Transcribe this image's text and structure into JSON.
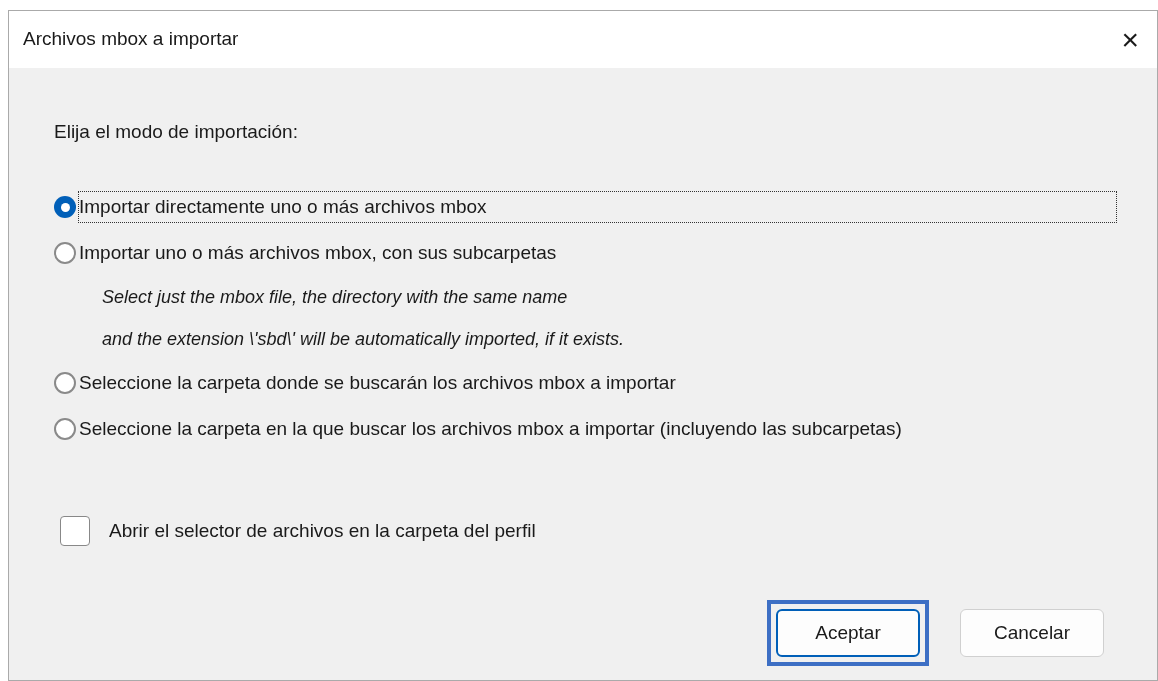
{
  "window": {
    "title": "Archivos mbox a importar",
    "close": "×"
  },
  "prompt": "Elija el modo de importación:",
  "options": [
    {
      "label": "Importar directamente uno o más archivos mbox",
      "selected": true,
      "focused": true
    },
    {
      "label": "Importar uno o más archivos mbox, con sus subcarpetas",
      "selected": false,
      "focused": false,
      "notes": [
        "Select just the mbox file, the directory with the same name",
        "and the extension \\'sbd\\' will be automatically imported, if it exists."
      ]
    },
    {
      "label": "Seleccione la carpeta donde se buscarán los archivos mbox a importar",
      "selected": false,
      "focused": false
    },
    {
      "label": "Seleccione la carpeta en la que buscar los archivos mbox a importar (incluyendo las subcarpetas)",
      "selected": false,
      "focused": false
    }
  ],
  "checkbox": {
    "label": "Abrir el selector de archivos en la carpeta del perfil",
    "checked": false
  },
  "buttons": [
    {
      "label": "Aceptar",
      "highlighted": true
    },
    {
      "label": "Cancelar",
      "highlighted": false
    }
  ]
}
